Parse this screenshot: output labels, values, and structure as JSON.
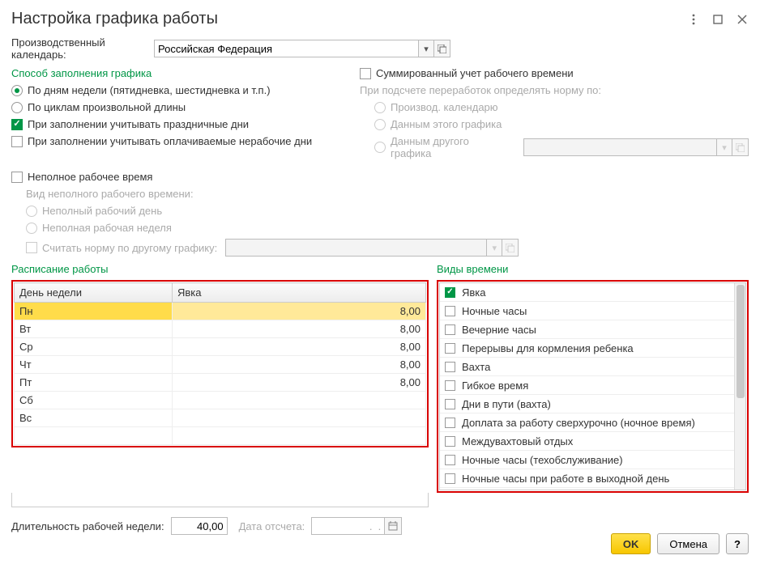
{
  "title": "Настройка графика работы",
  "calendar": {
    "label": "Производственный календарь:",
    "value": "Российская Федерация"
  },
  "fillMethod": {
    "title": "Способ заполнения графика",
    "byWeekDays": "По дням недели (пятидневка, шестидневка и т.п.)",
    "byCycles": "По циклам произвольной длины",
    "considerHolidays": "При заполнении учитывать праздничные дни",
    "considerPaidNonwork": "При заполнении учитывать оплачиваемые нерабочие дни"
  },
  "summed": {
    "check": "Суммированный учет рабочего времени",
    "normBy": "При подсчете переработок определять норму по:",
    "opt1": "Производ. календарю",
    "opt2": "Данным этого графика",
    "opt3": "Данным другого графика"
  },
  "parttime": {
    "check": "Неполное рабочее время",
    "kindLabel": "Вид неполного рабочего времени:",
    "opt1": "Неполный рабочий день",
    "opt2": "Неполная рабочая неделя",
    "normOther": "Считать норму по другому графику:"
  },
  "schedule": {
    "title": "Расписание работы",
    "colDay": "День недели",
    "colAttend": "Явка",
    "rows": [
      {
        "day": "Пн",
        "val": "8,00"
      },
      {
        "day": "Вт",
        "val": "8,00"
      },
      {
        "day": "Ср",
        "val": "8,00"
      },
      {
        "day": "Чт",
        "val": "8,00"
      },
      {
        "day": "Пт",
        "val": "8,00"
      },
      {
        "day": "Сб",
        "val": ""
      },
      {
        "day": "Вс",
        "val": ""
      }
    ]
  },
  "timeTypes": {
    "title": "Виды времени",
    "items": [
      {
        "label": "Явка",
        "checked": true
      },
      {
        "label": "Ночные часы",
        "checked": false
      },
      {
        "label": "Вечерние часы",
        "checked": false
      },
      {
        "label": "Перерывы для кормления ребенка",
        "checked": false
      },
      {
        "label": "Вахта",
        "checked": false
      },
      {
        "label": "Гибкое время",
        "checked": false
      },
      {
        "label": "Дни в пути (вахта)",
        "checked": false
      },
      {
        "label": "Доплата за работу сверхурочно (ночное время)",
        "checked": false
      },
      {
        "label": "Междувахтовый отдых",
        "checked": false
      },
      {
        "label": "Ночные часы (техобслуживание)",
        "checked": false
      },
      {
        "label": "Ночные часы при работе в выходной день",
        "checked": false
      }
    ]
  },
  "footer": {
    "weekLenLabel": "Длительность рабочей недели:",
    "weekLen": "40,00",
    "dateLabel": "Дата отсчета:",
    "datePlaceholder": ".  .",
    "ok": "OK",
    "cancel": "Отмена",
    "help": "?"
  }
}
